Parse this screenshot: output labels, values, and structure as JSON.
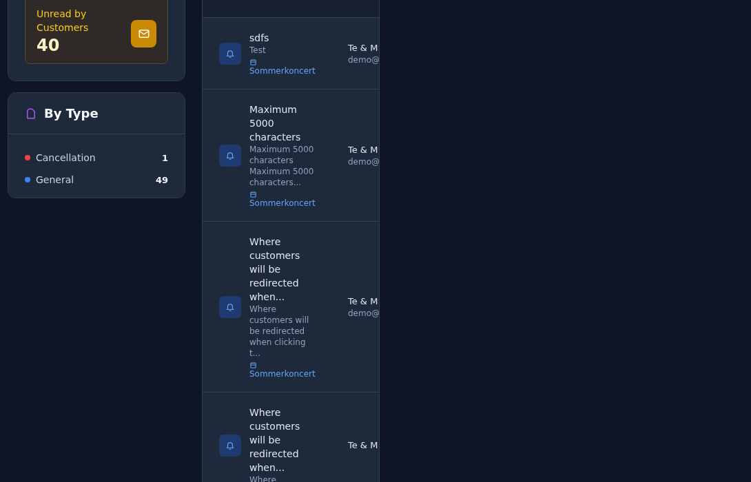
{
  "unread_card": {
    "label": "Unread by Customers",
    "value": "40"
  },
  "by_type": {
    "title": "By Type",
    "items": [
      {
        "label": "Cancellation",
        "count": "1",
        "color": "#ef4444"
      },
      {
        "label": "General",
        "count": "49",
        "color": "#3b82f6"
      }
    ]
  },
  "notifications": [
    {
      "title": "sdfs",
      "message": "Test",
      "event": "Sommerkoncert",
      "customer": {
        "name": "Te & M",
        "email": "demo@"
      }
    },
    {
      "title": "Maximum 5000 characters",
      "message": "Maximum 5000 characters Maximum 5000 characters...",
      "event": "Sommerkoncert",
      "customer": {
        "name": "Te & M",
        "email": "demo@"
      }
    },
    {
      "title": "Where customers will be redirected when...",
      "message": "Where customers will be redirected when clicking t...",
      "event": "Sommerkoncert",
      "customer": {
        "name": "Te & M",
        "email": "demo@"
      }
    },
    {
      "title": "Where customers will be redirected when...",
      "message": "Where",
      "customer": {
        "name": "Te & M"
      }
    }
  ]
}
